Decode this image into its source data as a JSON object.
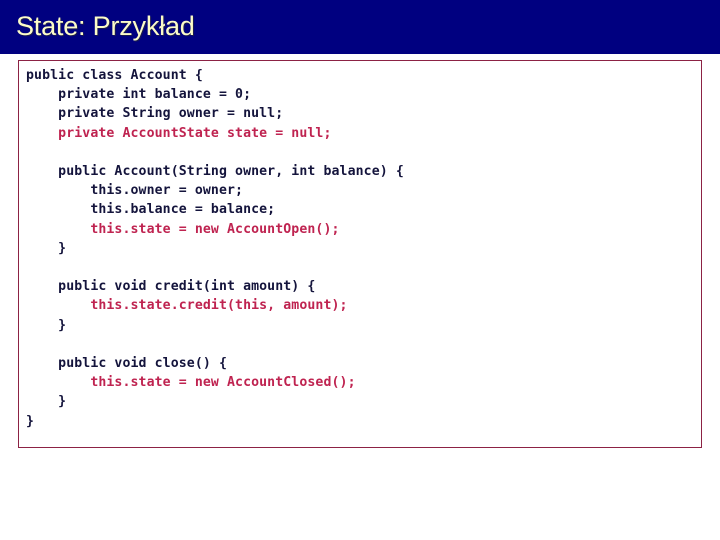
{
  "slide": {
    "title": "State: Przykład",
    "title_bar_color": "#000080",
    "title_text_color": "#fbfbc8",
    "background_color": "#ffffff"
  },
  "code_box": {
    "border_color": "#8c2244",
    "background_color": "#ffffff",
    "language": "java",
    "default_text_color": "#14143c",
    "highlight_text_color": "#bf2350",
    "lines": [
      {
        "text": "public class Account {",
        "style": "dark"
      },
      {
        "text": "    private int balance = 0;",
        "style": "dark"
      },
      {
        "text": "    private String owner = null;",
        "style": "dark"
      },
      {
        "text": "    private AccountState state = null;",
        "style": "red"
      },
      {
        "text": "",
        "style": "blank"
      },
      {
        "text": "    public Account(String owner, int balance) {",
        "style": "dark"
      },
      {
        "text": "        this.owner = owner;",
        "style": "dark"
      },
      {
        "text": "        this.balance = balance;",
        "style": "dark"
      },
      {
        "text": "        this.state = new AccountOpen();",
        "style": "red"
      },
      {
        "text": "    }",
        "style": "dark"
      },
      {
        "text": "",
        "style": "blank"
      },
      {
        "text": "    public void credit(int amount) {",
        "style": "dark"
      },
      {
        "text": "        this.state.credit(this, amount);",
        "style": "red"
      },
      {
        "text": "    }",
        "style": "dark"
      },
      {
        "text": "",
        "style": "blank"
      },
      {
        "text": "    public void close() {",
        "style": "dark"
      },
      {
        "text": "        this.state = new AccountClosed();",
        "style": "red"
      },
      {
        "text": "    }",
        "style": "dark"
      },
      {
        "text": "}",
        "style": "dark"
      }
    ]
  }
}
